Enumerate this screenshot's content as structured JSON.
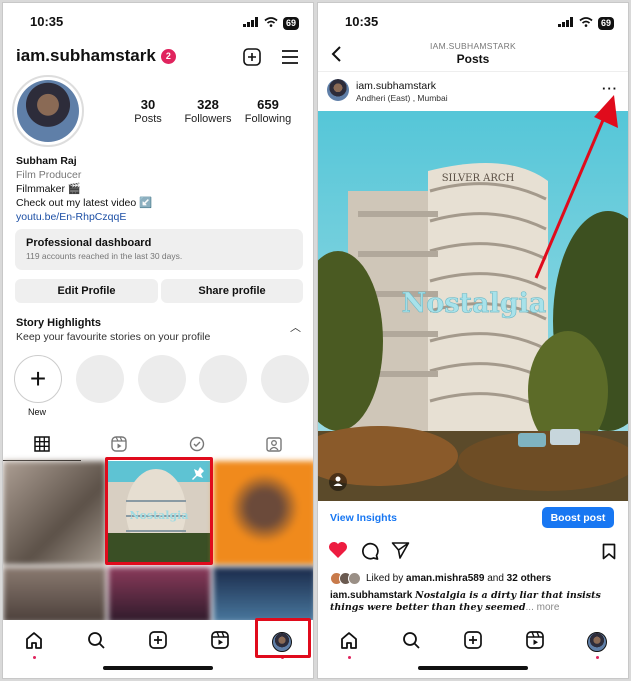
{
  "left": {
    "status": {
      "time": "10:35",
      "battery": "69"
    },
    "header": {
      "username": "iam.subhamstark",
      "notification_count": "2"
    },
    "stats": [
      {
        "num": "30",
        "label": "Posts"
      },
      {
        "num": "328",
        "label": "Followers"
      },
      {
        "num": "659",
        "label": "Following"
      }
    ],
    "bio": {
      "name": "Subham Raj",
      "category": "Film Producer",
      "line1": "Filmmaker 🎬",
      "line2": "Check out my latest video ↙️",
      "link": "youtu.be/En-RhpCzqqE"
    },
    "dashboard": {
      "title": "Professional dashboard",
      "subtitle": "119 accounts reached in the last 30 days."
    },
    "buttons": {
      "edit": "Edit Profile",
      "share": "Share profile"
    },
    "highlights": {
      "title": "Story Highlights",
      "subtitle": "Keep your favourite stories on your profile",
      "new_label": "New"
    }
  },
  "right": {
    "status": {
      "time": "10:35",
      "battery": "69"
    },
    "header": {
      "small": "IAM.SUBHAMSTARK",
      "title": "Posts"
    },
    "post": {
      "username": "iam.subhamstark",
      "location": "Andheri (East) , Mumbai",
      "sign_text": "SILVER ARCH",
      "overlay_text": "Nostalgia",
      "insights": "View Insights",
      "boost": "Boost post",
      "liked_by_prefix": "Liked by ",
      "liked_by_user": "aman.mishra589",
      "liked_by_and": " and ",
      "liked_by_others": "32 others",
      "caption_user": "iam.subhamstark",
      "caption_text": "Nostalgia is a dirty liar that insists things were better than they seemed",
      "caption_more": "... more"
    }
  },
  "colors": {
    "accent": "#1877f2",
    "notify": "#e0245e",
    "highlight_box": "#e00b1c"
  }
}
